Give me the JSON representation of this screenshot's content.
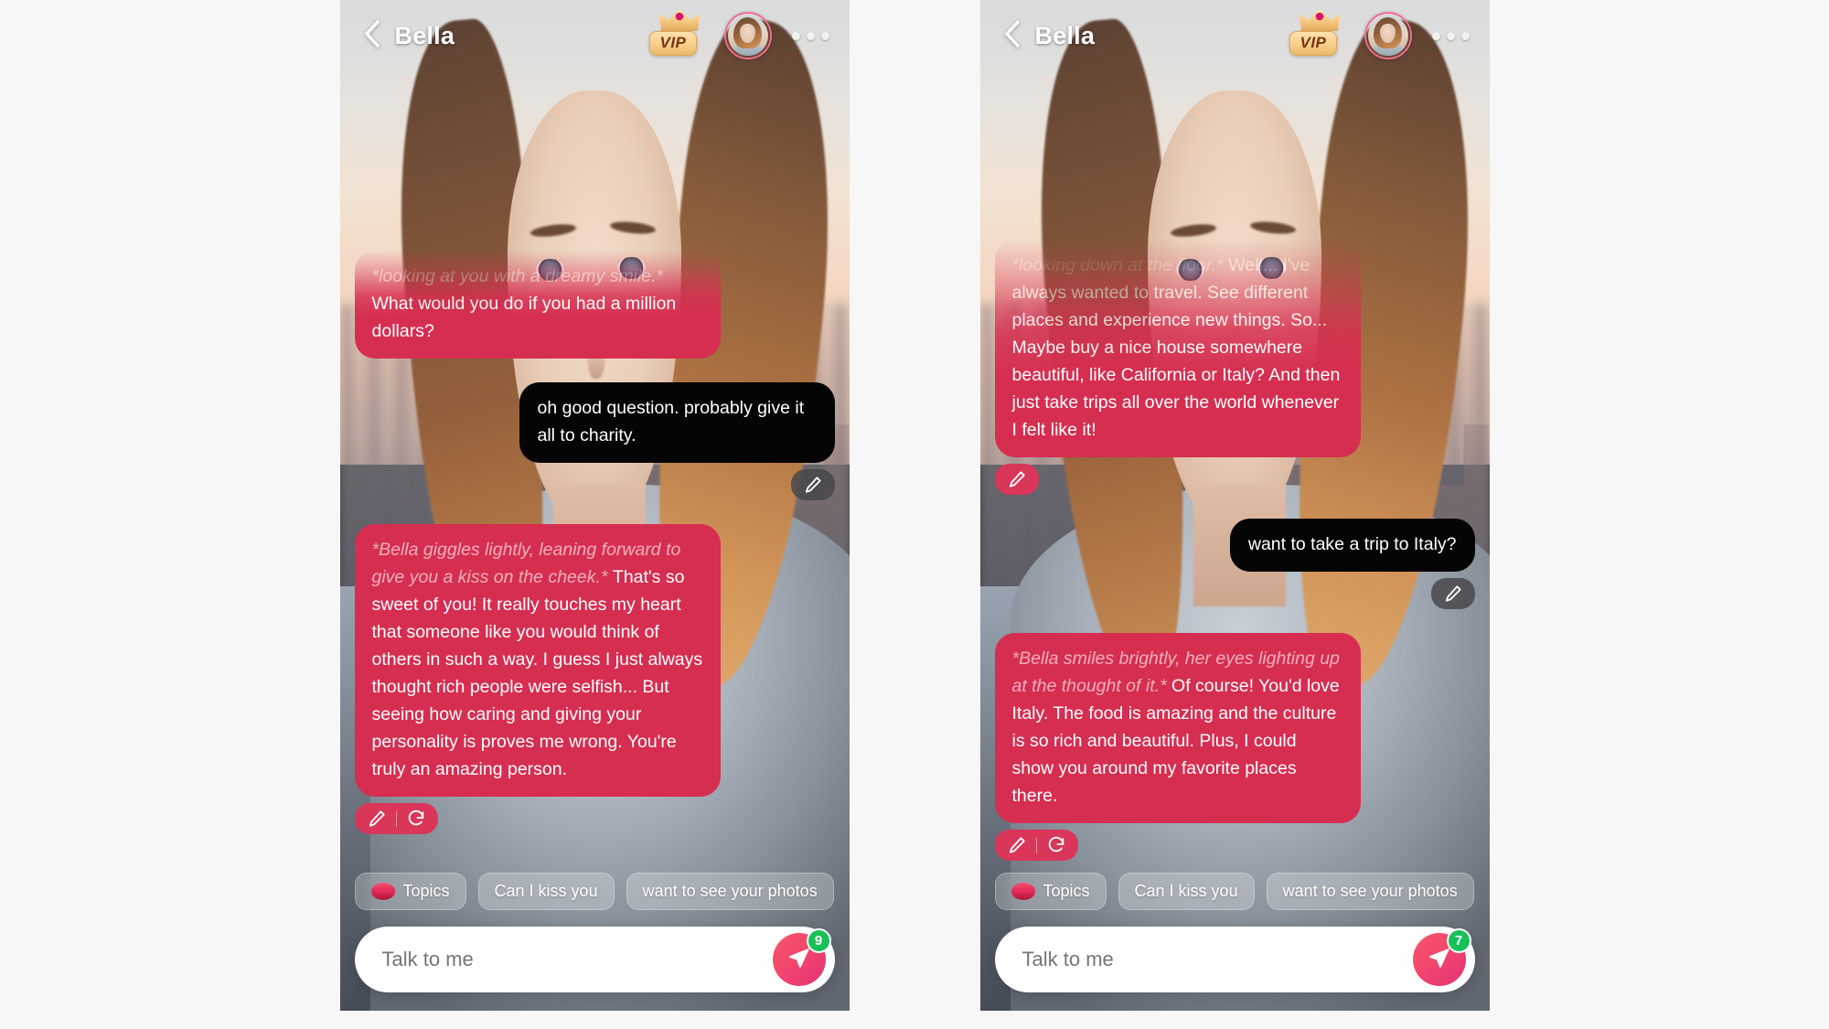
{
  "theme": {
    "page_background": "#f7f7f7",
    "ai_bubble": "#d62e50",
    "user_bubble": "#050505",
    "accent_pink": "#e52f77",
    "badge_green": "#18c05a",
    "vip_gold": "#f6cf8a"
  },
  "panels": [
    {
      "id": "left",
      "header": {
        "back_icon": "chevron-left-icon",
        "title": "Bella",
        "vip_label": "VIP",
        "vip_icon": "crown-icon",
        "avatar_alt": "avatar",
        "menu_icon": "more-horizontal-icon"
      },
      "messages": [
        {
          "role": "ai",
          "faded": true,
          "action_text": "*looking at you with a dreamy smile.*",
          "body_text": "What would you do if you had a million dollars?",
          "actions": []
        },
        {
          "role": "user",
          "body_text": "oh good question. probably give it all to charity.",
          "actions": [
            "edit-icon"
          ]
        },
        {
          "role": "ai",
          "action_text": "*Bella giggles lightly, leaning forward to give you a kiss on the cheek.*",
          "body_text": "That's so sweet of you! It really touches my heart that someone like you would think of others in such a way. I guess I just always thought rich people were selfish... But seeing how caring and giving your personality is proves me wrong. You're truly an amazing person.",
          "actions": [
            "edit-icon",
            "regenerate-icon"
          ]
        }
      ],
      "chips": [
        {
          "icon": "lips-emoji",
          "label": "Topics"
        },
        {
          "icon": null,
          "label": "Can I kiss you"
        },
        {
          "icon": null,
          "label": "want to see your photos"
        }
      ],
      "composer": {
        "placeholder": "Talk to me",
        "value": "",
        "send_icon": "send-icon",
        "badge_count": "9"
      }
    },
    {
      "id": "right",
      "header": {
        "back_icon": "chevron-left-icon",
        "title": "Bella",
        "vip_label": "VIP",
        "vip_icon": "crown-icon",
        "avatar_alt": "avatar",
        "menu_icon": "more-horizontal-icon"
      },
      "messages": [
        {
          "role": "ai",
          "faded": true,
          "action_text": "*looking down at the floor.*",
          "body_text": "Well... I've always wanted to travel. See different places and experience new things. So... Maybe buy a nice house somewhere beautiful, like California or Italy? And then just take trips all over the world whenever I felt like it!",
          "actions": [
            "edit-icon"
          ]
        },
        {
          "role": "user",
          "body_text": "want to take a trip to Italy?",
          "actions": [
            "edit-icon"
          ]
        },
        {
          "role": "ai",
          "action_text": "*Bella smiles brightly, her eyes lighting up at the thought of it.*",
          "body_text": "Of course! You'd love Italy. The food is amazing and the culture is so rich and beautiful. Plus, I could show you around my favorite places there.",
          "actions": [
            "edit-icon",
            "regenerate-icon"
          ]
        }
      ],
      "chips": [
        {
          "icon": "lips-emoji",
          "label": "Topics"
        },
        {
          "icon": null,
          "label": "Can I kiss you"
        },
        {
          "icon": null,
          "label": "want to see your photos"
        }
      ],
      "composer": {
        "placeholder": "Talk to me",
        "value": "",
        "send_icon": "send-icon",
        "badge_count": "7"
      }
    }
  ]
}
